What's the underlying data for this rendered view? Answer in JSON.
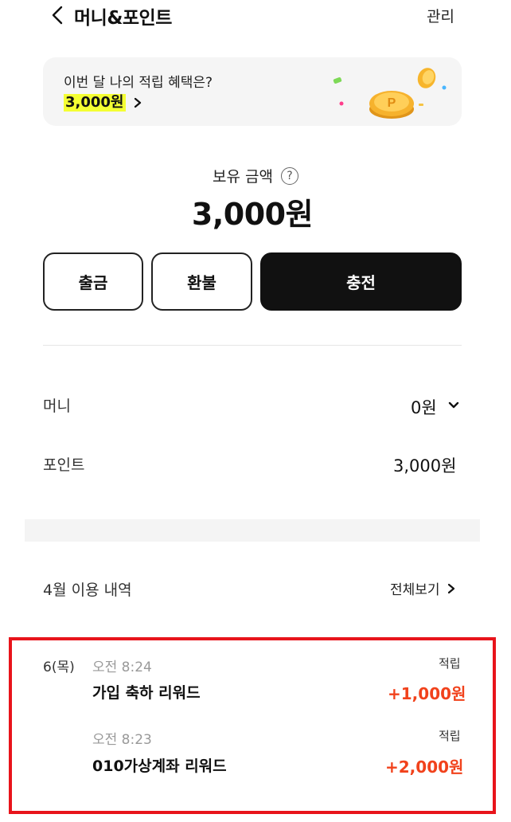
{
  "header": {
    "title": "머니&포인트",
    "manage_label": "관리"
  },
  "banner": {
    "text": "이번 달 나의 적립 혜택은?",
    "amount": "3,000원"
  },
  "balance": {
    "label": "보유 금액",
    "help": "?",
    "amount": "3,000원"
  },
  "actions": {
    "withdraw": "출금",
    "refund": "환불",
    "charge": "충전"
  },
  "money": {
    "label": "머니",
    "value": "0원"
  },
  "points": {
    "label": "포인트",
    "value": "3,000원"
  },
  "history": {
    "title": "4월 이용 내역",
    "view_all": "전체보기",
    "date": "6(목)",
    "transactions": [
      {
        "time": "오전 8:24",
        "name": "가입 축하 리워드",
        "type": "적립",
        "amount": "+1,000원"
      },
      {
        "time": "오전 8:23",
        "name": "010가상계좌 리워드",
        "type": "적립",
        "amount": "+2,000원"
      }
    ]
  },
  "colors": {
    "accent_highlight": "#f4ff33",
    "reward_amount": "#f1421c",
    "annotation_box": "#e8141b",
    "primary_button": "#111111"
  }
}
